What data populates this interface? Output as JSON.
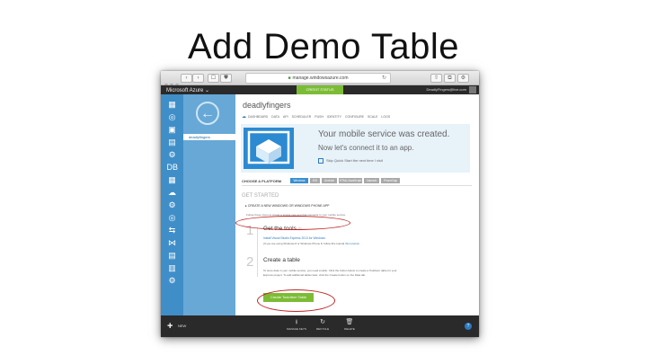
{
  "slide": {
    "title": "Add Demo Table"
  },
  "browser": {
    "url": "manage.windowsazure.com",
    "back": "‹",
    "forward": "›",
    "sidebar_toggle": "☐",
    "shield": "⛊",
    "reload": "↻",
    "share": "⇧",
    "tabs": "⧉",
    "settings": "⚙"
  },
  "portal": {
    "brand": "Microsoft Azure",
    "brand_caret": "⌄",
    "credit_label": "CREDIT STATUS",
    "account": "DeadlyFingers@live.com",
    "rail_icons": [
      "▦",
      "◎",
      "▣",
      "▤",
      "⚙",
      "DB",
      "▦",
      "☁",
      "⚙",
      "◎",
      "⇆",
      "⋈",
      "▤",
      "▥",
      "⚙"
    ],
    "back_arrow": "←",
    "nav_item": "deadlyfingers",
    "service_name": "deadlyfingers",
    "tabs": [
      "DASHBOARD",
      "DATA",
      "API",
      "SCHEDULER",
      "PUSH",
      "IDENTITY",
      "CONFIGURE",
      "SCALE",
      "LOGS"
    ],
    "hero_line1": "Your mobile service was created.",
    "hero_line2": "Now let's connect it to an app.",
    "skip_label": "Skip Quick Start the next time I visit",
    "platform_label": "CHOOSE A PLATFORM",
    "platforms": [
      "Windows",
      "iOS",
      "Android",
      "HTML/JavaScript",
      "Xamarin",
      "PhoneGap"
    ],
    "get_started": "GET STARTED",
    "create_app": "CREATE A NEW WINDOWS OR WINDOWS PHONE APP",
    "helper": "Follow these steps to create a simple new app that connects to your mobile service.",
    "step1_num": "1",
    "step1_title": "Get the tools",
    "step1_link": "Install Visual Studio Express 2013 for Windows",
    "step1_note_pre": "(If you are using Windows 8 or Windows Phone 8, follow this tutorial ",
    "step1_note_link": "this tutorial",
    "step1_note_post": ")",
    "step2_num": "2",
    "step2_title": "Create a table",
    "step2_desc1": "To store data in your mobile service, you need a table. Click the button below to create a TodoItem table for your",
    "step2_desc2": "Express project. To add additional tables later, click the Create button on the Data tab.",
    "create_button": "Create TodoItem Table",
    "new_label": "NEW",
    "bottom_items": [
      {
        "icon": "⭳",
        "label": "MANAGE KEYS"
      },
      {
        "icon": "↻",
        "label": "RECYCLE"
      },
      {
        "icon": "🗑",
        "label": "DELETE"
      }
    ],
    "help": "?"
  },
  "colors": {
    "azure_blue": "#3f8ec8",
    "green": "#7cbc35",
    "annotation_red": "#c02222"
  }
}
